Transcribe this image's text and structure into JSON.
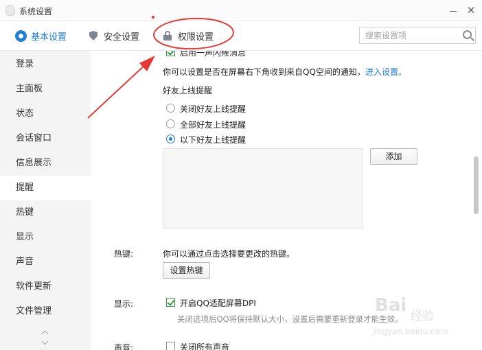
{
  "window": {
    "title": "系统设置",
    "min_label": "",
    "close_label": "✕"
  },
  "tabs": [
    {
      "label": "基本设置",
      "icon": "gear-icon",
      "active": true
    },
    {
      "label": "安全设置",
      "icon": "shield-icon",
      "active": false
    },
    {
      "label": "权限设置",
      "icon": "lock-icon",
      "active": false
    }
  ],
  "search": {
    "placeholder": "搜索设置项"
  },
  "sidebar": {
    "items": [
      {
        "label": "登录"
      },
      {
        "label": "主面板"
      },
      {
        "label": "状态"
      },
      {
        "label": "会话窗口"
      },
      {
        "label": "信息展示"
      },
      {
        "label": "提醒",
        "active": true
      },
      {
        "label": "热键"
      },
      {
        "label": "显示"
      },
      {
        "label": "声音"
      },
      {
        "label": "软件更新"
      },
      {
        "label": "文件管理"
      }
    ]
  },
  "content": {
    "partial_top_option": "启用一声闪候消息",
    "qzone_notice": "你可以设置是否在屏幕右下角收到来自QQ空间的通知，",
    "qzone_link": "进入设置。",
    "online_heading": "好友上线提醒",
    "online_options": [
      {
        "label": "关闭好友上线提醒",
        "selected": false
      },
      {
        "label": "全部好友上线提醒",
        "selected": false
      },
      {
        "label": "以下好友上线提醒",
        "selected": true
      }
    ],
    "add_button": "添加",
    "hotkey": {
      "label": "热键:",
      "description": "你可以通过点击选择要更改的热键。",
      "button": "设置热键"
    },
    "display": {
      "label": "显示:",
      "option": "开启QQ适配屏幕DPI",
      "checked": true,
      "note": "关闭选项后QQ将保持默认大小，设置后需要重新登录才能生效。"
    },
    "sound": {
      "label": "声音:",
      "option": "关闭所有声音",
      "checked": false
    }
  },
  "watermark": {
    "logo": "Bai",
    "logo2": "经验",
    "url": "jingyan.baidu.com"
  },
  "colors": {
    "accent": "#1e7bd6",
    "annotation": "#e53935",
    "check": "#3d9a45"
  }
}
